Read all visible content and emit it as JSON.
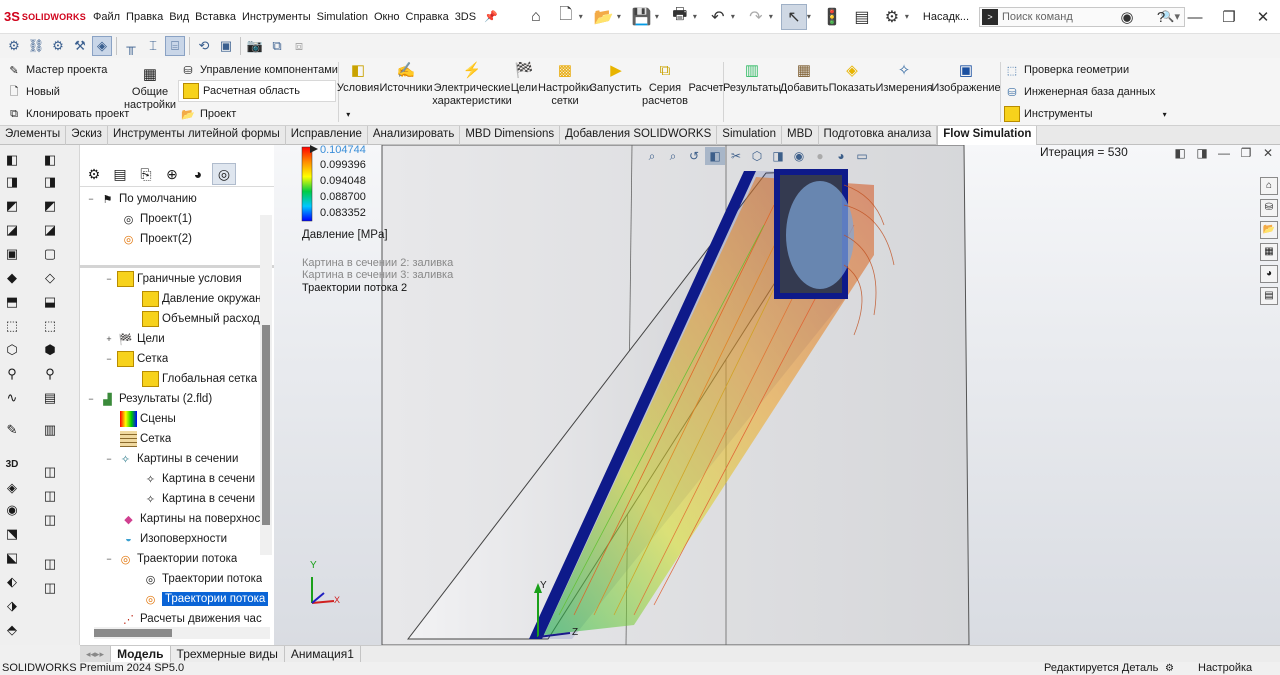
{
  "app": {
    "logo_text": "SOLIDWORKS",
    "logo_mark": "3S"
  },
  "menu": [
    "Файл",
    "Правка",
    "Вид",
    "Вставка",
    "Инструменты",
    "Simulation",
    "Окно",
    "Справка",
    "3DS"
  ],
  "quick_access": {
    "nasadka": "Насадк...",
    "search_placeholder": "Поиск команд"
  },
  "ribbon": {
    "left_small": [
      "Мастер проекта",
      "Новый",
      "Клонировать проект"
    ],
    "common_settings": "Общие настройки",
    "component_items": [
      "Управление компонентами",
      "Расчетная область",
      "Проект"
    ],
    "big_buttons": [
      {
        "label": "Условия",
        "icon": "conditions-icon"
      },
      {
        "label": "Источники",
        "icon": "sources-icon"
      },
      {
        "label": "Электрические характеристики",
        "icon": "electrical-icon"
      },
      {
        "label": "Цели",
        "icon": "goals-icon"
      },
      {
        "label": "Настройки сетки",
        "icon": "mesh-settings-icon"
      },
      {
        "label": "Запустить",
        "icon": "run-icon"
      },
      {
        "label": "Серия расчетов",
        "icon": "batch-run-icon"
      },
      {
        "label": "Расчет",
        "icon": "calc-icon"
      },
      {
        "label": "Результаты",
        "icon": "results-icon"
      },
      {
        "label": "Добавить",
        "icon": "add-icon"
      },
      {
        "label": "Показать",
        "icon": "show-icon"
      },
      {
        "label": "Измерения",
        "icon": "measure-icon"
      },
      {
        "label": "Изображение",
        "icon": "image-icon"
      }
    ],
    "right_small": [
      "Проверка геометрии",
      "Инженерная база данных",
      "Инструменты"
    ]
  },
  "tabs": [
    "Элементы",
    "Эскиз",
    "Инструменты литейной формы",
    "Исправление",
    "Анализировать",
    "MBD Dimensions",
    "Добавления SOLIDWORKS",
    "Simulation",
    "MBD",
    "Подготовка анализа",
    "Flow Simulation"
  ],
  "active_tab": "Flow Simulation",
  "tree": {
    "top": [
      {
        "label": "По умолчанию",
        "level": 0
      },
      {
        "label": "Проект(1)",
        "level": 1
      },
      {
        "label": "Проект(2)",
        "level": 1
      }
    ],
    "items": [
      {
        "label": "Граничные условия",
        "level": 1,
        "exp": "−"
      },
      {
        "label": "Давление окружан",
        "level": 2
      },
      {
        "label": "Объемный расход",
        "level": 2
      },
      {
        "label": "Цели",
        "level": 1,
        "exp": "+"
      },
      {
        "label": "Сетка",
        "level": 1,
        "exp": "−"
      },
      {
        "label": "Глобальная сетка",
        "level": 2
      },
      {
        "label": "Результаты (2.fld)",
        "level": 0,
        "exp": "−"
      },
      {
        "label": "Сцены",
        "level": 1
      },
      {
        "label": "Сетка",
        "level": 1
      },
      {
        "label": "Картины в сечении",
        "level": 1,
        "exp": "−"
      },
      {
        "label": "Картина в сечени",
        "level": 2
      },
      {
        "label": "Картина в сечени",
        "level": 2
      },
      {
        "label": "Картины на поверхнос",
        "level": 1
      },
      {
        "label": "Изоповерхности",
        "level": 1
      },
      {
        "label": "Траектории потока",
        "level": 1,
        "exp": "−"
      },
      {
        "label": "Траектории потока",
        "level": 2
      },
      {
        "label": "Траектории потока",
        "level": 2,
        "selected": true
      },
      {
        "label": "Расчеты движения час",
        "level": 1
      }
    ]
  },
  "legend": {
    "values": [
      "0.104744",
      "0.099396",
      "0.094048",
      "0.088700",
      "0.083352"
    ],
    "title": "Давление [MPa]",
    "colors": [
      "#ff0000",
      "#ff8c00",
      "#ffff00",
      "#00cc44",
      "#00c8ff",
      "#0000ff"
    ]
  },
  "messages": [
    "Картина в сечении 2: заливка",
    "Картина в сечении 3: заливка",
    "Траектории потока 2"
  ],
  "iteration": "Итерация = 530",
  "triad": {
    "y": "Y",
    "x": "X",
    "z": "Z"
  },
  "bottom_tabs": [
    "Модель",
    "Трехмерные виды",
    "Анимация1"
  ],
  "active_bottom_tab": "Модель",
  "status": {
    "left": "SOLIDWORKS Premium 2024 SP5.0",
    "editing": "Редактируется Деталь",
    "settings": "Настройка"
  }
}
